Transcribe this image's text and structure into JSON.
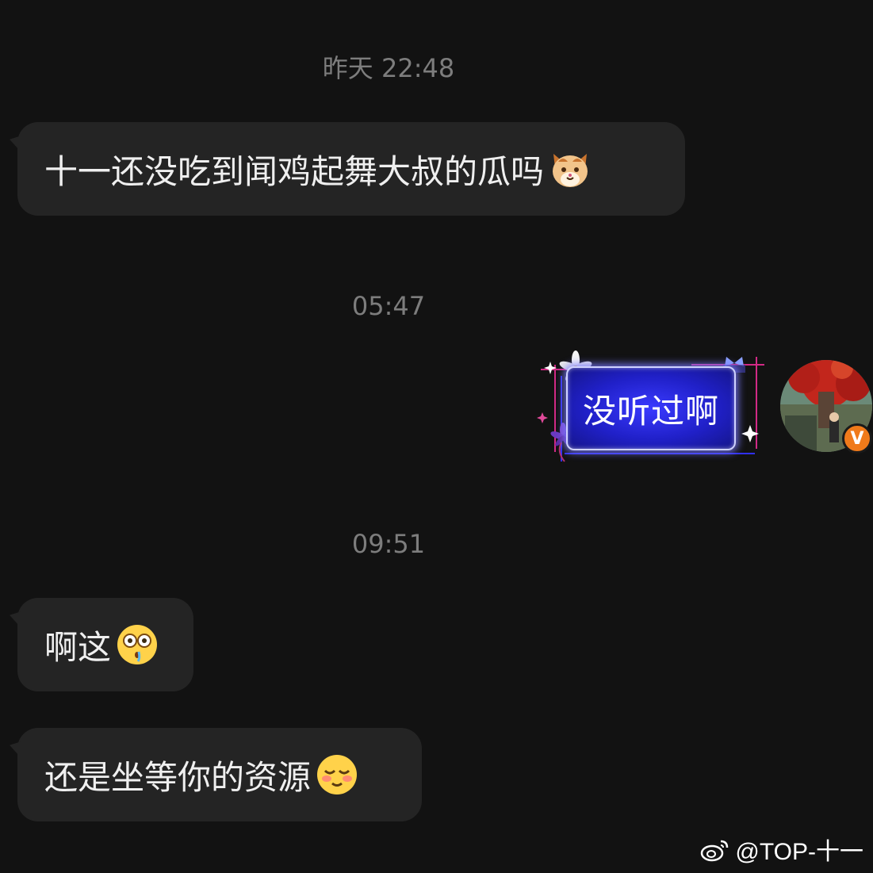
{
  "messages": [
    {
      "type": "timestamp",
      "text": "昨天 22:48"
    },
    {
      "type": "incoming",
      "text": "十一还没吃到闻鸡起舞大叔的瓜吗",
      "emoji": "cat-face-emoji"
    },
    {
      "type": "timestamp",
      "text": "05:47"
    },
    {
      "type": "outgoing",
      "text": "没听过啊"
    },
    {
      "type": "timestamp",
      "text": "09:51"
    },
    {
      "type": "incoming",
      "text": "啊这",
      "emoji": "flushed-face-emoji"
    },
    {
      "type": "incoming",
      "text": "还是坐等你的资源",
      "emoji": "blushing-face-emoji"
    }
  ],
  "avatar": {
    "badge": "V",
    "badge_color": "#f07a1a"
  },
  "watermark": {
    "icon": "weibo-icon",
    "text": "@TOP-十一"
  },
  "colors": {
    "background": "#121212",
    "incoming_bubble": "#242424",
    "timestamp": "#7d7d7d",
    "outgoing_bubble": "#2a2ae0"
  }
}
